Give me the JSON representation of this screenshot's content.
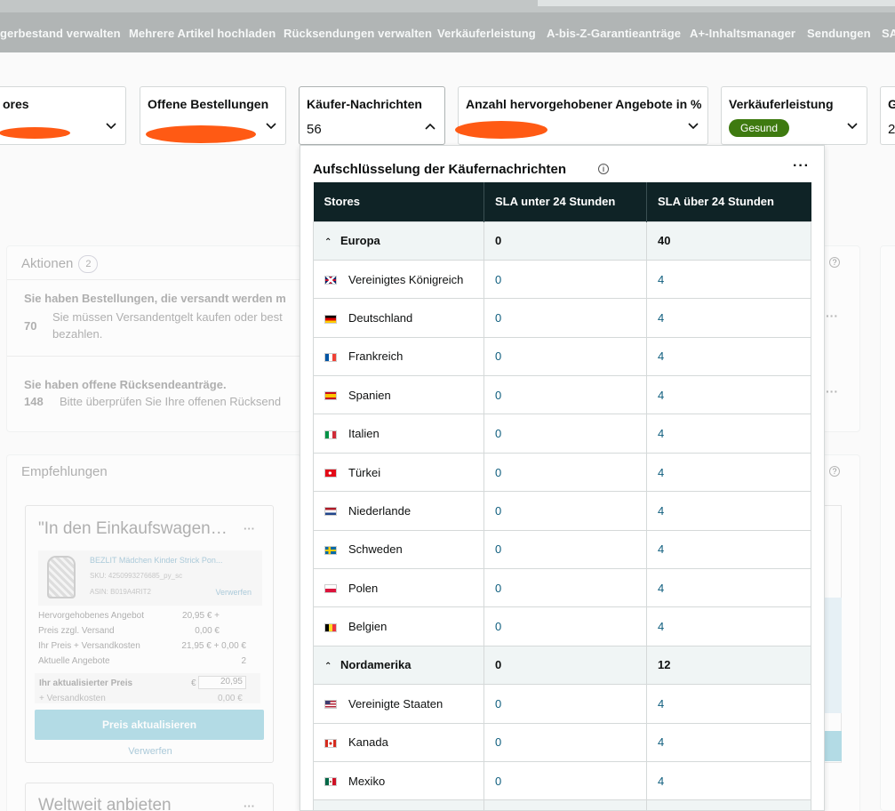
{
  "nav": {
    "items": [
      "gerbestand verwalten",
      "Mehrere Artikel hochladen",
      "Rücksendungen verwalten",
      "Verkäuferleistung",
      "A-bis-Z-Garantieanträge",
      "A+-Inhaltsmanager",
      "Sendungen",
      "SA"
    ]
  },
  "kpis": {
    "stores": {
      "title": "ores"
    },
    "orders": {
      "title": "Offene Bestellungen"
    },
    "messages": {
      "title": "Käufer-Nachrichten",
      "value": "56"
    },
    "featured": {
      "title": "Anzahl hervorgehobener Angebote in %"
    },
    "performance": {
      "title": "Verkäuferleistung",
      "badge": "Gesund"
    },
    "cut": {
      "title": "G",
      "value": "2"
    }
  },
  "actions": {
    "title": "Aktionen",
    "count": "2",
    "item1": {
      "title": "Sie haben Bestellungen, die versandt werden m",
      "number": "70",
      "desc": "Sie müssen Versandentgelt kaufen oder best",
      "desc2": "bezahlen."
    },
    "item2": {
      "title": "Sie haben offene Rücksendeanträge.",
      "number": "148",
      "desc": "Bitte überprüfen Sie Ihre offenen Rücksend"
    }
  },
  "recommendations": {
    "title": "Empfehlungen",
    "card1": {
      "title": "\"In den Einkaufswagen…",
      "product": "BEZLIT Mädchen Kinder Strick Pon...",
      "sku": "SKU: 4250993276685_py_sc",
      "asin": "ASIN: B019A4RIT2",
      "discard_small": "Verwerfen",
      "rows": [
        {
          "label": "Hervorgehobenes Angebot",
          "value": "20,95 € +"
        },
        {
          "label": "Preis zzgl. Versand",
          "value": "0,00 €"
        },
        {
          "label": "Ihr Preis + Versandkosten",
          "value": "21,95 € + 0,00 €"
        },
        {
          "label": "Aktuelle Angebote",
          "value": "2"
        }
      ],
      "updated_label": "Ihr aktualisierter Preis",
      "currency": "€",
      "updated_value": "20,95",
      "shipping_label": "+ Versandkosten",
      "shipping_value": "0,00 €",
      "button": "Preis aktualisieren",
      "discard": "Verwerfen"
    },
    "card2": {
      "title": "Weltweit anbieten"
    }
  },
  "popup": {
    "title": "Aufschlüsselung der Käufernachrichten",
    "headers": [
      "Stores",
      "SLA unter 24 Stunden",
      "SLA über 24 Stunden"
    ],
    "rows": [
      {
        "type": "region",
        "name": "Europa",
        "under": "0",
        "over": "40"
      },
      {
        "type": "country",
        "flag": "gb",
        "name": "Vereinigtes Königreich",
        "under": "0",
        "over": "4"
      },
      {
        "type": "country",
        "flag": "de",
        "name": "Deutschland",
        "under": "0",
        "over": "4"
      },
      {
        "type": "country",
        "flag": "fr",
        "name": "Frankreich",
        "under": "0",
        "over": "4"
      },
      {
        "type": "country",
        "flag": "es",
        "name": "Spanien",
        "under": "0",
        "over": "4"
      },
      {
        "type": "country",
        "flag": "it",
        "name": "Italien",
        "under": "0",
        "over": "4"
      },
      {
        "type": "country",
        "flag": "tr",
        "name": "Türkei",
        "under": "0",
        "over": "4"
      },
      {
        "type": "country",
        "flag": "nl",
        "name": "Niederlande",
        "under": "0",
        "over": "4"
      },
      {
        "type": "country",
        "flag": "se",
        "name": "Schweden",
        "under": "0",
        "over": "4"
      },
      {
        "type": "country",
        "flag": "pl",
        "name": "Polen",
        "under": "0",
        "over": "4"
      },
      {
        "type": "country",
        "flag": "be",
        "name": "Belgien",
        "under": "0",
        "over": "4"
      },
      {
        "type": "region",
        "name": "Nordamerika",
        "under": "0",
        "over": "12"
      },
      {
        "type": "country",
        "flag": "us",
        "name": "Vereinigte Staaten",
        "under": "0",
        "over": "4"
      },
      {
        "type": "country",
        "flag": "ca",
        "name": "Kanada",
        "under": "0",
        "over": "4"
      },
      {
        "type": "country",
        "flag": "mx",
        "name": "Mexiko",
        "under": "0",
        "over": "4"
      }
    ]
  },
  "colors": {
    "accent_dark": "#0f2326",
    "brand_orange": "#ff5a14",
    "healthy_green": "#3e7a10",
    "link_teal": "#0f5e7e"
  }
}
